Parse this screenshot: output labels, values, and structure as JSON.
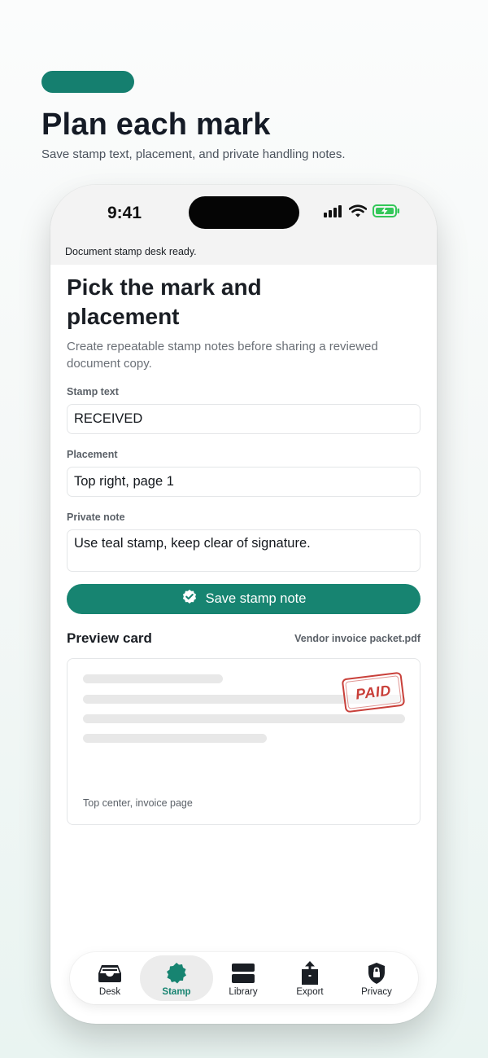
{
  "hero": {
    "title": "Plan each mark",
    "subtitle": "Save stamp text, placement, and private handling notes."
  },
  "status_bar": {
    "time": "9:41",
    "icons": [
      "signal-icon",
      "wifi-icon",
      "battery-charging-icon"
    ]
  },
  "banner": "Document stamp desk ready.",
  "page": {
    "title": "Pick the mark and placement",
    "description": "Create repeatable stamp notes before sharing a reviewed document copy."
  },
  "form": {
    "stamp_text_label": "Stamp text",
    "stamp_text_value": "RECEIVED",
    "placement_label": "Placement",
    "placement_value": "Top right, page 1",
    "note_label": "Private note",
    "note_value": "Use teal stamp, keep clear of signature.",
    "save_label": "Save stamp note"
  },
  "preview": {
    "title": "Preview card",
    "file_name": "Vendor invoice packet.pdf",
    "stamp_text": "PAID",
    "caption": "Top center, invoice page"
  },
  "tabs": [
    {
      "label": "Desk",
      "icon": "inbox-tray-icon",
      "active": false
    },
    {
      "label": "Stamp",
      "icon": "stamp-badge-icon",
      "active": true
    },
    {
      "label": "Library",
      "icon": "library-stack-icon",
      "active": false
    },
    {
      "label": "Export",
      "icon": "share-upload-icon",
      "active": false
    },
    {
      "label": "Privacy",
      "icon": "lock-shield-icon",
      "active": false
    }
  ],
  "colors": {
    "accent": "#178471",
    "stamp_red": "#c9403a",
    "battery_green": "#34c759"
  }
}
